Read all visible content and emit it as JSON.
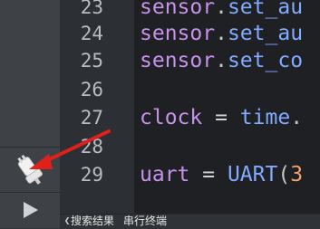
{
  "editor": {
    "lines": [
      {
        "no": "23",
        "tokens": [
          {
            "t": "sensor",
            "c": "tok-ident"
          },
          {
            "t": ".",
            "c": "tok-punct"
          },
          {
            "t": "set_au",
            "c": "tok-method"
          }
        ]
      },
      {
        "no": "24",
        "tokens": [
          {
            "t": "sensor",
            "c": "tok-ident"
          },
          {
            "t": ".",
            "c": "tok-punct"
          },
          {
            "t": "set_au",
            "c": "tok-method"
          }
        ]
      },
      {
        "no": "25",
        "tokens": [
          {
            "t": "sensor",
            "c": "tok-ident"
          },
          {
            "t": ".",
            "c": "tok-punct"
          },
          {
            "t": "set_co",
            "c": "tok-method"
          }
        ]
      },
      {
        "no": "26",
        "tokens": []
      },
      {
        "no": "27",
        "tokens": [
          {
            "t": "clock",
            "c": "tok-ident2"
          },
          {
            "t": " = ",
            "c": "tok-op"
          },
          {
            "t": "time",
            "c": "tok-method"
          },
          {
            "t": ".",
            "c": "tok-punct"
          }
        ]
      },
      {
        "no": "28",
        "tokens": []
      },
      {
        "no": "29",
        "tokens": [
          {
            "t": "uart",
            "c": "tok-ident2"
          },
          {
            "t": " = ",
            "c": "tok-op"
          },
          {
            "t": "UART",
            "c": "tok-method"
          },
          {
            "t": "(",
            "c": "tok-punct"
          },
          {
            "t": "3",
            "c": "tok-num"
          }
        ]
      }
    ]
  },
  "bottom_tabs": [
    "搜索结果",
    "串行终端"
  ],
  "icons": {
    "connect": "usb-plug-icon",
    "run": "play-icon",
    "scroll_left": "chevron-left-icon",
    "annotation": "red-arrow-icon"
  },
  "colors": {
    "annotation_arrow": "#e0201b",
    "background": "#1e2024"
  }
}
